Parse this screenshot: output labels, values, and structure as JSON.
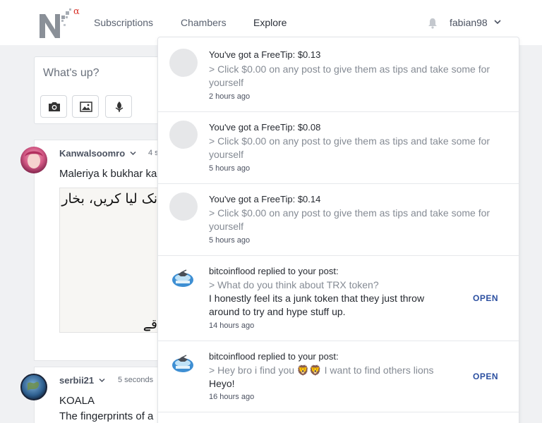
{
  "header": {
    "nav": [
      "Subscriptions",
      "Chambers",
      "Explore"
    ],
    "logo_suffix": "α",
    "username": "fabian98"
  },
  "compose": {
    "placeholder": "What's up?"
  },
  "posts": [
    {
      "user": "Kanwalsoomro",
      "time": "4 s",
      "text": "Maleriya k bukhar ka",
      "image_text_top": "نک لیا کریں، بخار",
      "image_text_bottom": "قے"
    },
    {
      "user": "serbii21",
      "time": "5 seconds",
      "title": "KOALA",
      "text": "The fingerprints of a"
    }
  ],
  "notifications": [
    {
      "type": "tip",
      "title": "You've got a FreeTip: $0.13",
      "subtitle": "> Click $0.00 on any post to give them as tips and take some for yourself",
      "time": "2 hours ago"
    },
    {
      "type": "tip",
      "title": "You've got a FreeTip: $0.08",
      "subtitle": "> Click $0.00 on any post to give them as tips and take some for yourself",
      "time": "5 hours ago"
    },
    {
      "type": "tip",
      "title": "You've got a FreeTip: $0.14",
      "subtitle": "> Click $0.00 on any post to give them as tips and take some for yourself",
      "time": "5 hours ago"
    },
    {
      "type": "reply",
      "title": "bitcoinflood replied to your post:",
      "subtitle": "> What do you think about TRX token?",
      "body": "I honestly feel its a junk token that they just throw around to try and hype stuff up.",
      "time": "14 hours ago",
      "action": "OPEN"
    },
    {
      "type": "reply",
      "title": "bitcoinflood replied to your post:",
      "subtitle": "> Hey bro i find you 🦁🦁 I want to find others lions",
      "body": "Heyo!",
      "time": "16 hours ago",
      "action": "OPEN"
    }
  ],
  "colors": {
    "accent": "#2b4fa0",
    "logo_alpha": "#d9342b",
    "background": "#f0f1f3"
  }
}
